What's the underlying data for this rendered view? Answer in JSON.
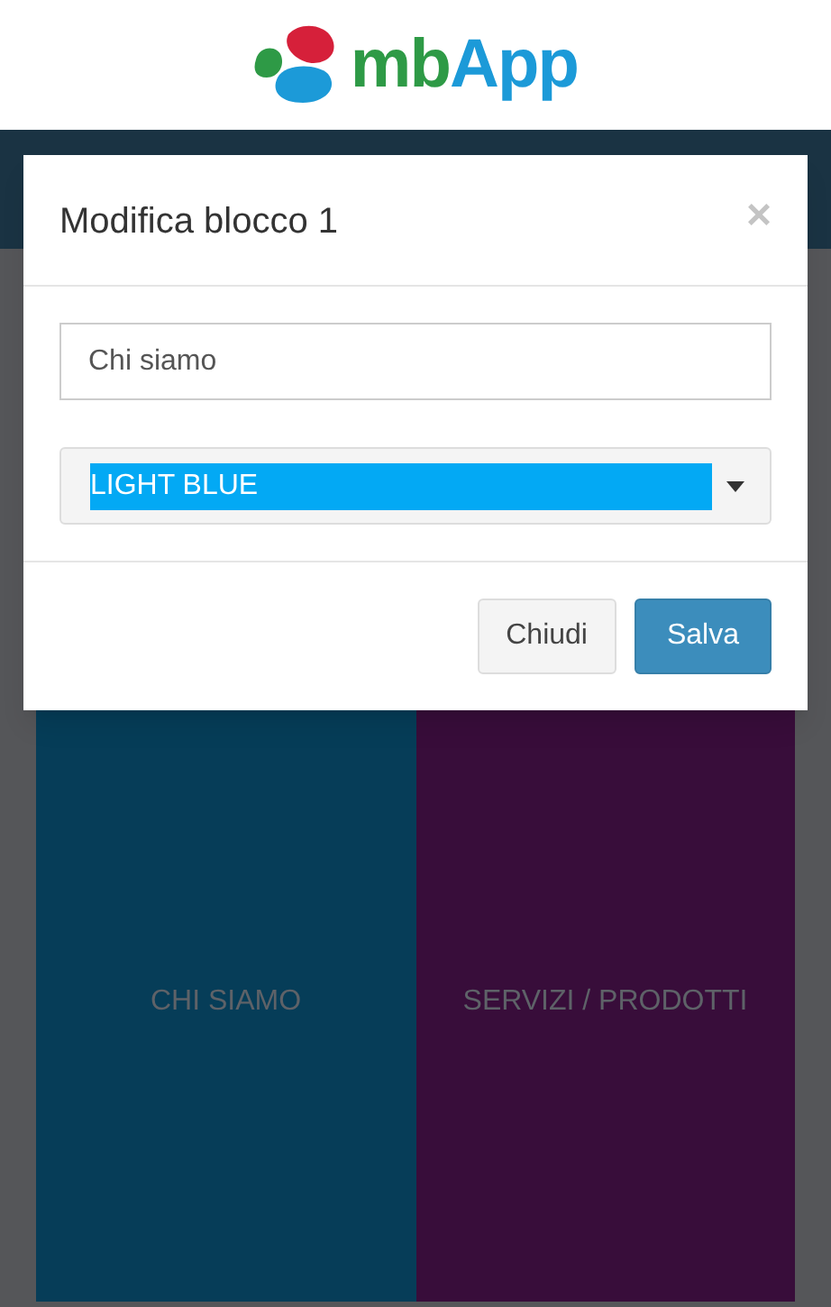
{
  "header": {
    "logo_parts": [
      {
        "text": "mb",
        "color": "#2e9a46"
      },
      {
        "text": "App",
        "color": "#1c9ad8"
      }
    ]
  },
  "modal": {
    "title": "Modifica blocco 1",
    "close": "×",
    "name_field": {
      "value": "Chi siamo"
    },
    "color_select": {
      "value": "LIGHT BLUE"
    },
    "buttons": [
      {
        "label": "Chiudi",
        "kind": "default"
      },
      {
        "label": "Salva",
        "kind": "primary"
      }
    ]
  },
  "blocks": [
    {
      "label": "CHI SIAMO",
      "color": "#063d58"
    },
    {
      "label": "SERVIZI / PRODOTTI",
      "color": "#380d3a"
    }
  ]
}
